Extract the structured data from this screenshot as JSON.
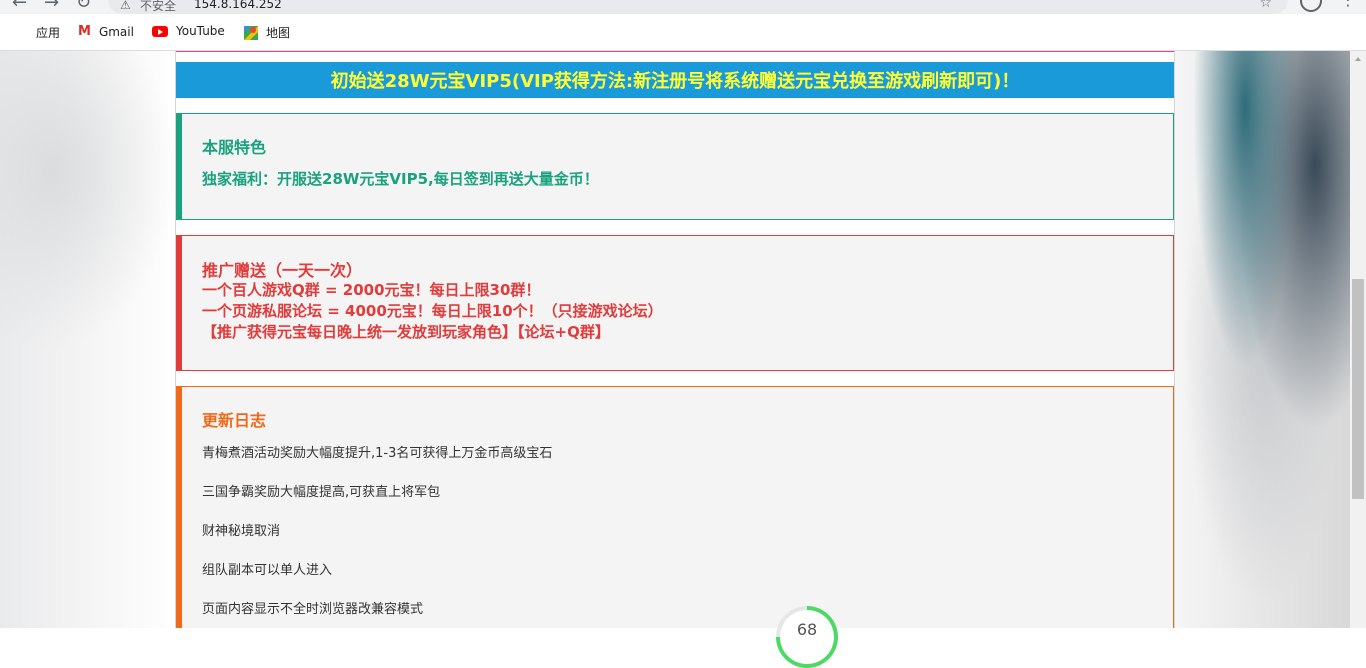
{
  "browser": {
    "security_label": "不安全",
    "url": "154.8.164.252",
    "bookmarks": [
      {
        "label": "应用"
      },
      {
        "label": "Gmail"
      },
      {
        "label": "YouTube"
      },
      {
        "label": "地图"
      }
    ]
  },
  "page": {
    "banner": "初始送28W元宝VIP5(VIP获得方法:新注册号将系统赠送元宝兑换至游戏刷新即可)！",
    "features": {
      "title": "本服特色",
      "line": "独家福利：开服送28W元宝VIP5,每日签到再送大量金币！"
    },
    "promotion": {
      "title": "推广赠送（一天一次）",
      "lines": [
        "一个百人游戏Q群 = 2000元宝！每日上限30群！",
        "一个页游私服论坛 = 4000元宝！每日上限10个！（只接游戏论坛）",
        "【推广获得元宝每日晚上统一发放到玩家角色】【论坛+Q群】"
      ]
    },
    "changelog": {
      "title": "更新日志",
      "items": [
        "青梅煮酒活动奖励大幅度提升,1-3名可获得上万金币高级宝石",
        "三国争霸奖励大幅度提高,可获直上将军包",
        "财神秘境取消",
        "组队副本可以单人进入",
        "页面内容显示不全时浏览器改兼容模式"
      ]
    },
    "gauge_value": "68",
    "gauge_percent": 75
  },
  "colors": {
    "banner_bg": "#1a9ad9",
    "banner_text": "#ffff33",
    "green": "#1aa27f",
    "red": "#e23b3b",
    "orange": "#ef6a1a"
  }
}
